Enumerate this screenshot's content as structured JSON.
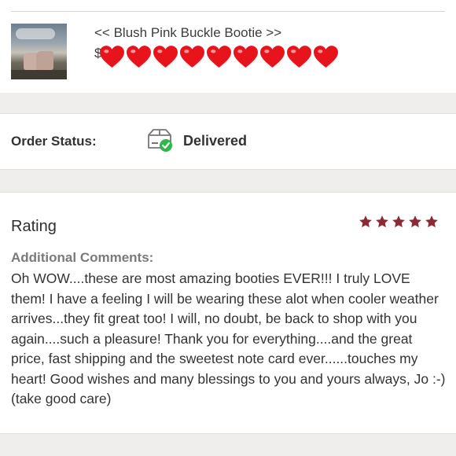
{
  "product": {
    "title": "<< Blush Pink Buckle Bootie >>",
    "price_text": "$",
    "heart_count": 9,
    "heart_color": "#e8141c"
  },
  "order": {
    "status_label": "Order Status:",
    "status_value": "Delivered",
    "status_icon": "delivered-box-check-icon",
    "check_color": "#2db84b"
  },
  "review": {
    "rating_label": "Rating",
    "rating_value": 5,
    "rating_max": 5,
    "star_color": "#8b2a35",
    "comments_label": "Additional Comments:",
    "comments_text": "Oh WOW....these are most amazing booties EVER!!! I truly LOVE them! I have a feeling I will be wearing these alot when cooler weather arrives...they fit great too! I will, no doubt, be back to shop with you again....such a pleasure! Thank you for everything....and the great price, fast shipping and the sweetest note card ever......touches my heart! Good wishes and many blessings to you and yours always, Jo :-) (take good care)"
  }
}
